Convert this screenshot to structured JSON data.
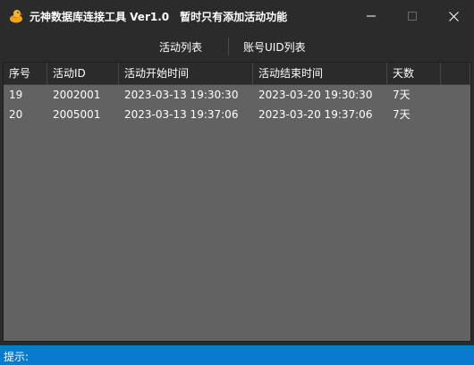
{
  "window": {
    "title": "元神数据库连接工具 Ver1.0",
    "subtitle": "暂时只有添加活动功能",
    "icon": "duck-icon"
  },
  "tabs": [
    {
      "label": "活动列表"
    },
    {
      "label": "账号UID列表"
    }
  ],
  "table": {
    "columns": [
      "序号",
      "活动ID",
      "活动开始时间",
      "活动结束时间",
      "天数"
    ],
    "rows": [
      {
        "index": "19",
        "activity_id": "2002001",
        "start": "2023-03-13 19:30:30",
        "end": "2023-03-20 19:30:30",
        "days": "7天"
      },
      {
        "index": "20",
        "activity_id": "2005001",
        "start": "2023-03-13 19:37:06",
        "end": "2023-03-20 19:37:06",
        "days": "7天"
      }
    ]
  },
  "status": {
    "label": "提示:"
  },
  "colors": {
    "titlebar": "#2b2b2b",
    "grid_background": "#626262",
    "statusbar": "#0a7acc",
    "duck": "#f5a623"
  }
}
